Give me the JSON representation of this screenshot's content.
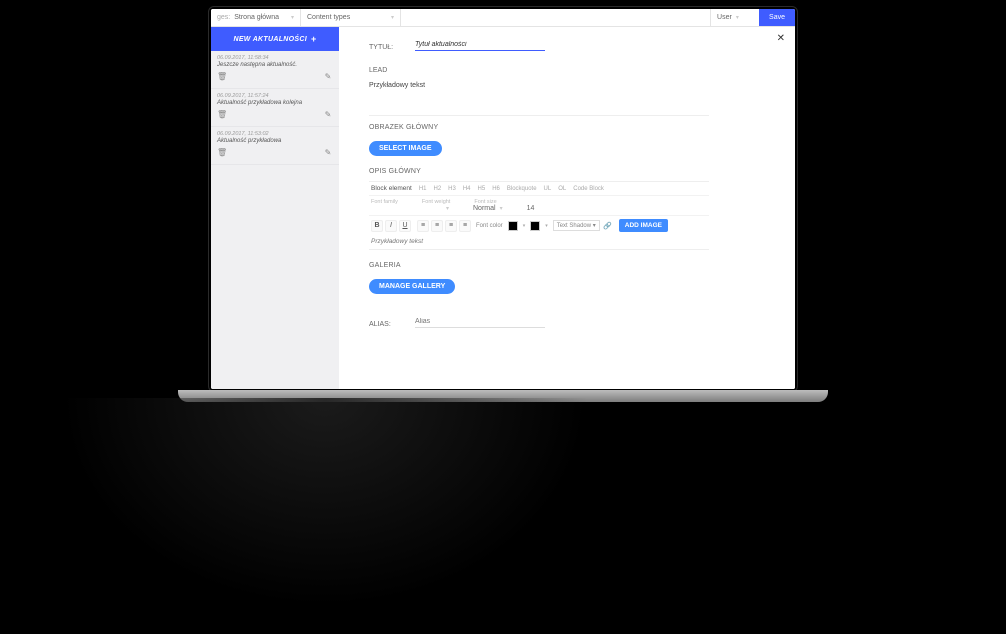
{
  "topbar": {
    "pages_label": "ges:",
    "home": "Strona główna",
    "content_types": "Content types",
    "user": "User",
    "save": "Save"
  },
  "sidebar": {
    "new_button_prefix": "NEW ",
    "new_button_word": "AKTUALNOŚCI",
    "items": [
      {
        "timestamp": "06.09.2017, 11:58:34",
        "title": "Jeszcze następna aktualność."
      },
      {
        "timestamp": "06.09.2017, 11:57:24",
        "title": "Aktualność przykładowa kolejna"
      },
      {
        "timestamp": "06.09.2017, 11:53:02",
        "title": "Aktualność przykładowa"
      }
    ]
  },
  "form": {
    "title_label": "TYTUŁ:",
    "title_value": "Tytuł aktualności",
    "lead_label": "LEAD",
    "lead_value": "Przykładowy tekst",
    "main_image_label": "OBRAZEK GŁÓWNY",
    "select_image_btn": "SELECT IMAGE",
    "main_desc_label": "OPIS GŁÓWNY",
    "gallery_label": "GALERIA",
    "manage_gallery_btn": "MANAGE GALLERY",
    "alias_label": "ALIAS:",
    "alias_placeholder": "Alias"
  },
  "editor": {
    "block_element": "Block element",
    "headings": [
      "H1",
      "H2",
      "H3",
      "H4",
      "H5",
      "H6"
    ],
    "blockquote": "Blockquote",
    "ul": "UL",
    "ol": "OL",
    "codeblock": "Code Block",
    "ff_label": "Font family",
    "fw_label": "Font weight",
    "fw_value": "Normal",
    "fs_label": "Font size",
    "fs_value": "14",
    "font_color_label": "Font color",
    "text_shadow_label": "Text Shadow",
    "add_image_btn": "ADD IMAGE",
    "body_text": "Przykładowy tekst"
  }
}
